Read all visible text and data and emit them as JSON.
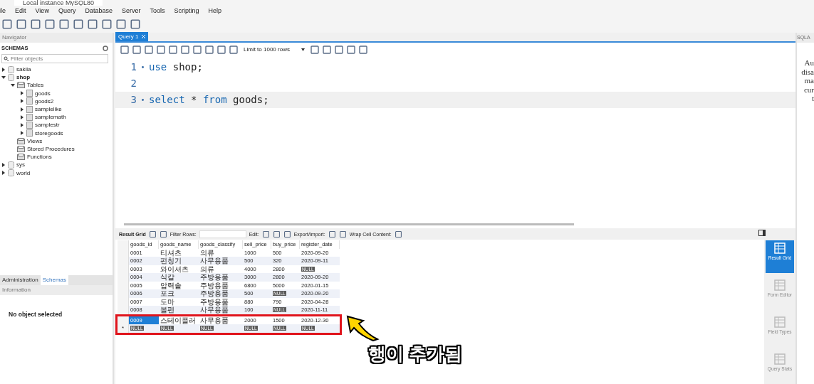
{
  "window": {
    "title": "Local instance MySQL80"
  },
  "menu": [
    "ile",
    "Edit",
    "View",
    "Query",
    "Database",
    "Server",
    "Tools",
    "Scripting",
    "Help"
  ],
  "navigator": {
    "title": "Navigator",
    "section": "SCHEMAS",
    "filter_placeholder": "Filter objects",
    "tree": [
      {
        "label": "sakila",
        "kind": "schema",
        "expanded": false,
        "default": false
      },
      {
        "label": "shop",
        "kind": "schema",
        "expanded": true,
        "default": true,
        "children": [
          {
            "label": "Tables",
            "kind": "folder",
            "expanded": true,
            "children": [
              {
                "label": "goods",
                "kind": "table",
                "expanded": false
              },
              {
                "label": "goods2",
                "kind": "table",
                "expanded": false
              },
              {
                "label": "samplelike",
                "kind": "table",
                "expanded": false
              },
              {
                "label": "samplemath",
                "kind": "table",
                "expanded": false
              },
              {
                "label": "samplestr",
                "kind": "table",
                "expanded": false
              },
              {
                "label": "storegoods",
                "kind": "table",
                "expanded": false
              }
            ]
          },
          {
            "label": "Views",
            "kind": "folder"
          },
          {
            "label": "Stored Procedures",
            "kind": "folder"
          },
          {
            "label": "Functions",
            "kind": "folder"
          }
        ]
      },
      {
        "label": "sys",
        "kind": "schema",
        "expanded": false,
        "default": false
      },
      {
        "label": "world",
        "kind": "schema",
        "expanded": false,
        "default": false
      }
    ]
  },
  "bottom_tabs": [
    {
      "label": "Administration",
      "selected": false
    },
    {
      "label": "Schemas",
      "selected": true
    }
  ],
  "information": {
    "title": "Information",
    "message": "No object selected"
  },
  "editor": {
    "tab": "Query 1",
    "limit": "Limit to 1000 rows",
    "lines": [
      {
        "number": "1",
        "marker": "•",
        "current": false,
        "tokens": [
          {
            "text": "use",
            "kind": "keyword"
          },
          {
            "text": " shop;",
            "kind": "plain"
          }
        ]
      },
      {
        "number": "2",
        "current": false
      },
      {
        "number": "3",
        "marker": "•",
        "current": true,
        "tokens": [
          {
            "text": "select",
            "kind": "keyword"
          },
          {
            "text": " * ",
            "kind": "plain"
          },
          {
            "text": "from",
            "kind": "keyword"
          },
          {
            "text": " goods;",
            "kind": "plain"
          }
        ]
      }
    ]
  },
  "result": {
    "grid_label": "Result Grid",
    "filter_label": "Filter Rows:",
    "edit_label": "Edit:",
    "export_label": "Export/Import:",
    "wrap_label": "Wrap Cell Content:",
    "columns": [
      "goods_id",
      "goods_name",
      "goods_classify",
      "sell_price",
      "buy_price",
      "register_date"
    ],
    "rows": [
      {
        "selected": false,
        "cells": [
          "0001",
          "티셔츠",
          "의류",
          "1000",
          "500",
          "2020-09-20"
        ]
      },
      {
        "selected": false,
        "cells": [
          "0002",
          "펀칭기",
          "사무용품",
          "500",
          "320",
          "2020-09-11"
        ]
      },
      {
        "selected": false,
        "cells": [
          "0003",
          "와이셔츠",
          "의류",
          "4000",
          "2800",
          {
            "text": "NULL",
            "kind": "null"
          }
        ]
      },
      {
        "selected": false,
        "cells": [
          "0004",
          "식칼",
          "주방용품",
          "3000",
          "2800",
          "2020-09-20"
        ]
      },
      {
        "selected": false,
        "cells": [
          "0005",
          "압력솥",
          "주방용품",
          "6800",
          "5000",
          "2020-01-15"
        ]
      },
      {
        "selected": false,
        "cells": [
          "0006",
          "포크",
          "주방용품",
          "500",
          {
            "text": "NULL",
            "kind": "null"
          },
          "2020-09-20"
        ]
      },
      {
        "selected": false,
        "cells": [
          "0007",
          "도마",
          "주방용품",
          "880",
          "790",
          "2020-04-28"
        ]
      },
      {
        "selected": false,
        "cells": [
          "0008",
          "볼펜",
          "사무용품",
          "100",
          {
            "text": "NULL",
            "kind": "null"
          },
          "2020-11-11"
        ]
      },
      {
        "selected": true,
        "annotated": true,
        "cells": [
          "0009",
          "스테이플러",
          "사무용품",
          "2000",
          "1500",
          "2020-12-30"
        ]
      },
      {
        "selected": false,
        "annotated": true,
        "marker": "*",
        "cells": [
          {
            "text": "NULL",
            "kind": "null"
          },
          {
            "text": "NULL",
            "kind": "null"
          },
          {
            "text": "NULL",
            "kind": "null"
          },
          {
            "text": "NULL",
            "kind": "null"
          },
          {
            "text": "NULL",
            "kind": "null"
          },
          {
            "text": "NULL",
            "kind": "null"
          }
        ]
      }
    ],
    "views": [
      {
        "label": "Result Grid",
        "selected": true
      },
      {
        "label": "Form Editor",
        "selected": false
      },
      {
        "label": "Field Types",
        "selected": false
      },
      {
        "label": "Query Stats",
        "selected": false
      }
    ]
  },
  "right_panel": {
    "title": "SQLA",
    "lines": [
      "Au",
      "disa",
      "ma",
      "cur",
      "t"
    ]
  },
  "annotation": {
    "caption": "행이 추가됨"
  }
}
